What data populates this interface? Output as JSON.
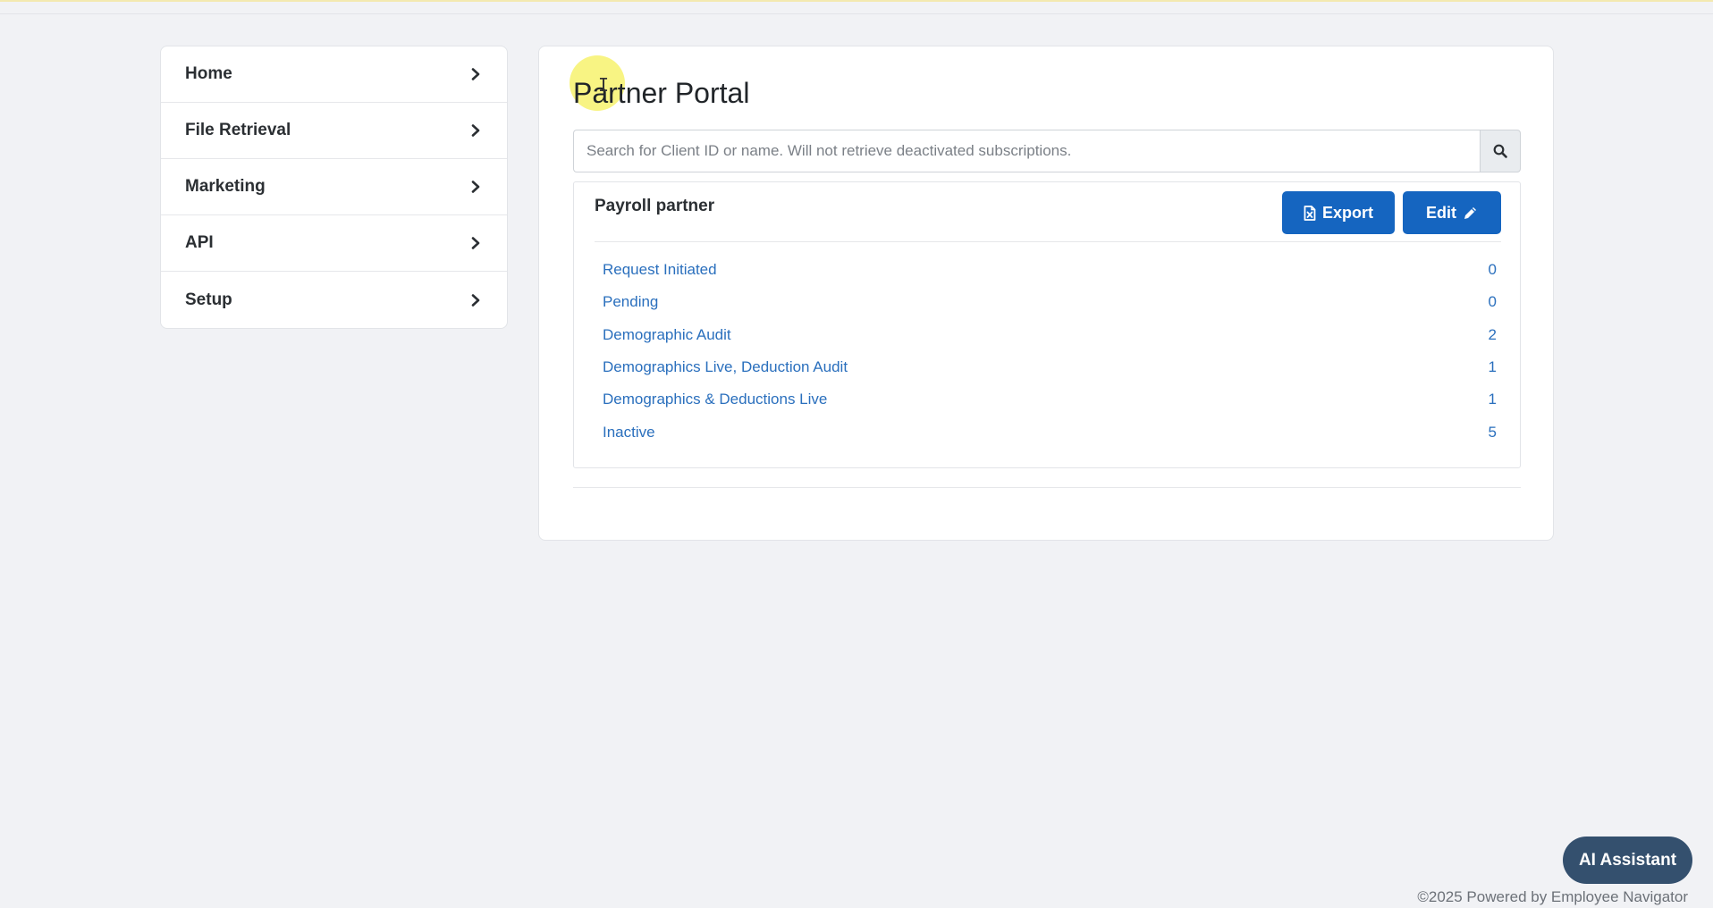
{
  "sidebar": {
    "items": [
      {
        "label": "Home"
      },
      {
        "label": "File Retrieval"
      },
      {
        "label": "Marketing"
      },
      {
        "label": "API"
      },
      {
        "label": "Setup"
      }
    ]
  },
  "main": {
    "title": "Partner Portal",
    "search": {
      "placeholder": "Search for Client ID or name. Will not retrieve deactivated subscriptions.",
      "value": ""
    },
    "partner": {
      "name": "Payroll partner",
      "export_label": "Export",
      "edit_label": "Edit",
      "statuses": [
        {
          "label": "Request Initiated",
          "count": "0"
        },
        {
          "label": "Pending",
          "count": "0"
        },
        {
          "label": "Demographic Audit",
          "count": "2"
        },
        {
          "label": "Demographics Live, Deduction Audit",
          "count": "1"
        },
        {
          "label": "Demographics & Deductions Live",
          "count": "1"
        },
        {
          "label": "Inactive",
          "count": "5"
        }
      ]
    }
  },
  "ai_assistant": {
    "label": "AI Assistant"
  },
  "footer": {
    "text": "©2025 Powered by Employee Navigator"
  },
  "icons": {
    "chevron": "chevron-right-icon",
    "search": "search-icon",
    "export": "file-excel-icon",
    "edit": "pencil-icon"
  },
  "colors": {
    "primary": "#1565c0",
    "link": "#2a6fbd",
    "ai_button": "#34506e",
    "background": "#f1f2f5"
  }
}
